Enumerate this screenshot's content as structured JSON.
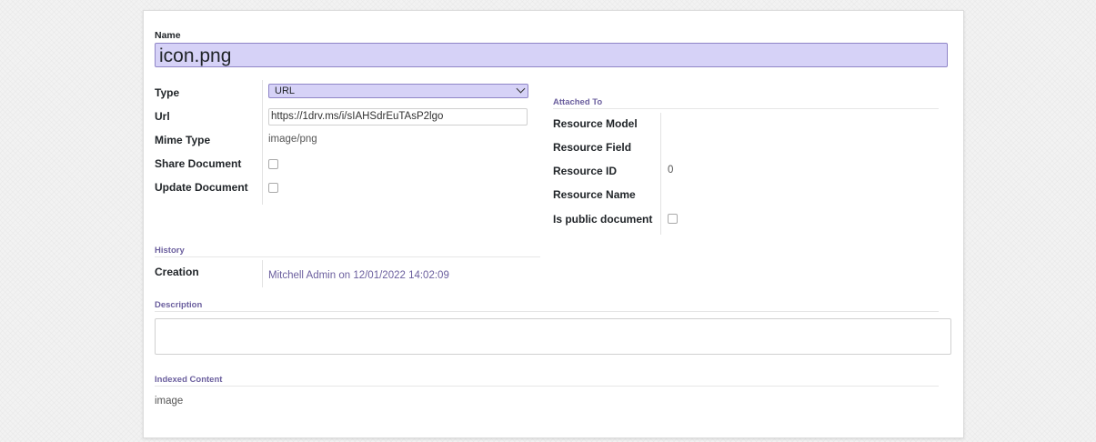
{
  "form": {
    "name_label": "Name",
    "name_value": "icon.png",
    "type_label": "Type",
    "type_value": "URL",
    "url_label": "Url",
    "url_value": "https://1drv.ms/i/sIAHSdrEuTAsP2lgo",
    "mime_label": "Mime Type",
    "mime_value": "image/png",
    "share_label": "Share Document",
    "update_label": "Update Document"
  },
  "attached": {
    "title": "Attached To",
    "resource_model_label": "Resource Model",
    "resource_field_label": "Resource Field",
    "resource_id_label": "Resource ID",
    "resource_id_value": "0",
    "resource_name_label": "Resource Name",
    "is_public_label": "Is public document"
  },
  "history": {
    "title": "History",
    "creation_label": "Creation",
    "creation_user": "Mitchell Admin",
    "creation_on": " on 12/01/2022 14:02:09"
  },
  "description": {
    "title": "Description"
  },
  "indexed": {
    "title": "Indexed Content",
    "value": "image"
  },
  "colors": {
    "accent": "#6b5f9e",
    "field_bg": "#d6d2f7"
  }
}
